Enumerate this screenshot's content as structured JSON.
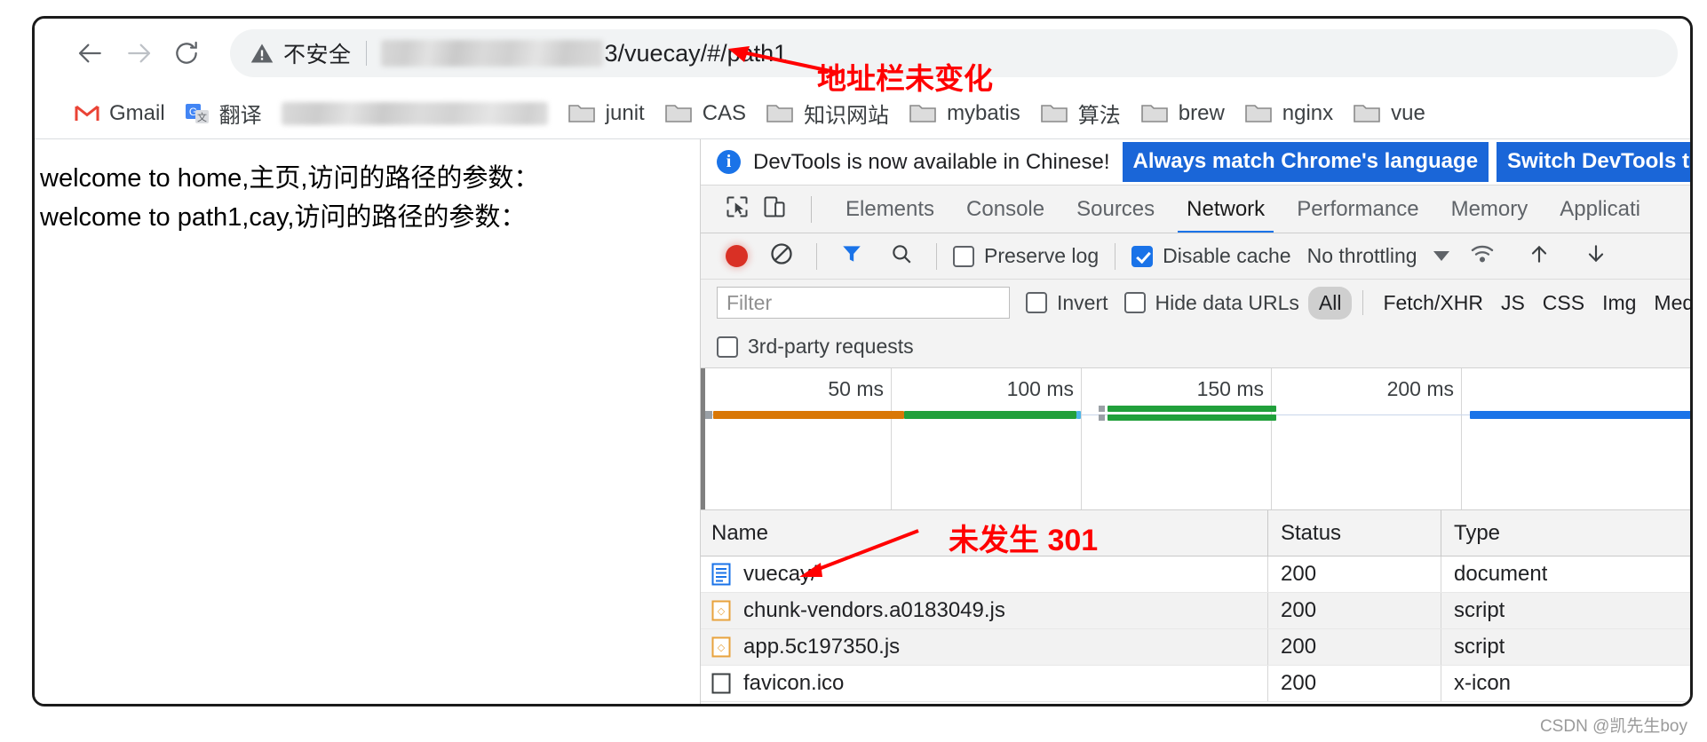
{
  "browser": {
    "nav": {
      "back_icon": "back-arrow-icon",
      "forward_icon": "forward-arrow-icon",
      "reload_icon": "reload-icon"
    },
    "omnibox": {
      "security_label": "不安全",
      "warning_icon": "warning-triangle-icon",
      "url_visible_suffix": "3/vuecay/#/path1",
      "url_redacted": true
    },
    "bookmarks": [
      {
        "label": "Gmail",
        "icon": "gmail-icon"
      },
      {
        "label": "翻译",
        "icon": "google-translate-icon"
      },
      {
        "label": "",
        "icon": "redacted-bookmark",
        "redacted": true
      },
      {
        "label": "junit",
        "icon": "folder-icon"
      },
      {
        "label": "CAS",
        "icon": "folder-icon"
      },
      {
        "label": "知识网站",
        "icon": "folder-icon"
      },
      {
        "label": "mybatis",
        "icon": "folder-icon"
      },
      {
        "label": "算法",
        "icon": "folder-icon"
      },
      {
        "label": "brew",
        "icon": "folder-icon"
      },
      {
        "label": "nginx",
        "icon": "folder-icon"
      },
      {
        "label": "vue",
        "icon": "folder-icon"
      }
    ]
  },
  "page": {
    "lines": [
      "welcome to home,主页,访问的路径的参数：",
      "welcome to path1,cay,访问的路径的参数："
    ]
  },
  "devtools": {
    "banner": {
      "icon": "info-icon",
      "message": "DevTools is now available in Chinese!",
      "primary_button": "Always match Chrome's language",
      "secondary_button": "Switch DevTools to Chi"
    },
    "toolbar_icons": {
      "inspect": "inspect-cursor-icon",
      "device": "device-toolbar-icon"
    },
    "tabs": [
      {
        "label": "Elements",
        "active": false
      },
      {
        "label": "Console",
        "active": false
      },
      {
        "label": "Sources",
        "active": false
      },
      {
        "label": "Network",
        "active": true
      },
      {
        "label": "Performance",
        "active": false
      },
      {
        "label": "Memory",
        "active": false
      },
      {
        "label": "Applicati",
        "active": false
      }
    ],
    "network_toolbar": {
      "record_icon": "record-stop-icon",
      "clear_icon": "clear-icon",
      "filter_icon": "filter-funnel-icon",
      "search_icon": "search-icon",
      "preserve_log_label": "Preserve log",
      "preserve_log_checked": false,
      "disable_cache_label": "Disable cache",
      "disable_cache_checked": true,
      "throttling_label": "No throttling",
      "throttling_caret": "chevron-down-icon",
      "wifi_icon": "network-conditions-icon",
      "import_icon": "import-har-icon",
      "export_icon": "export-har-icon"
    },
    "filter_bar": {
      "filter_placeholder": "Filter",
      "filter_value": "",
      "invert_label": "Invert",
      "invert_checked": false,
      "hide_data_urls_label": "Hide data URLs",
      "hide_data_urls_checked": false,
      "types": [
        "All",
        "Fetch/XHR",
        "JS",
        "CSS",
        "Img",
        "Media"
      ],
      "selected_type": "All",
      "third_party_label": "3rd-party requests",
      "third_party_checked": false
    },
    "overview": {
      "ticks": [
        "50 ms",
        "100 ms",
        "150 ms",
        "200 ms"
      ],
      "bar_colors": {
        "request": "#d97706",
        "download": "#21a03b",
        "other": "#1a73e8",
        "cap": "#9aa0a6"
      }
    },
    "requests": {
      "columns": [
        "Name",
        "Status",
        "Type"
      ],
      "rows": [
        {
          "icon": "document-icon",
          "name": "vuecay/",
          "status": "200",
          "type": "document"
        },
        {
          "icon": "script-icon",
          "name": "chunk-vendors.a0183049.js",
          "status": "200",
          "type": "script"
        },
        {
          "icon": "script-icon",
          "name": "app.5c197350.js",
          "status": "200",
          "type": "script"
        },
        {
          "icon": "generic-file-icon",
          "name": "favicon.ico",
          "status": "200",
          "type": "x-icon"
        }
      ]
    }
  },
  "annotations": [
    {
      "text": "地址栏未变化",
      "color": "#ff0000",
      "arrow": "red-arrow-left"
    },
    {
      "text": "未发生 301",
      "color": "#ff0000",
      "arrow": "red-arrow-down-left"
    }
  ],
  "watermark": "CSDN @凯先生boy"
}
